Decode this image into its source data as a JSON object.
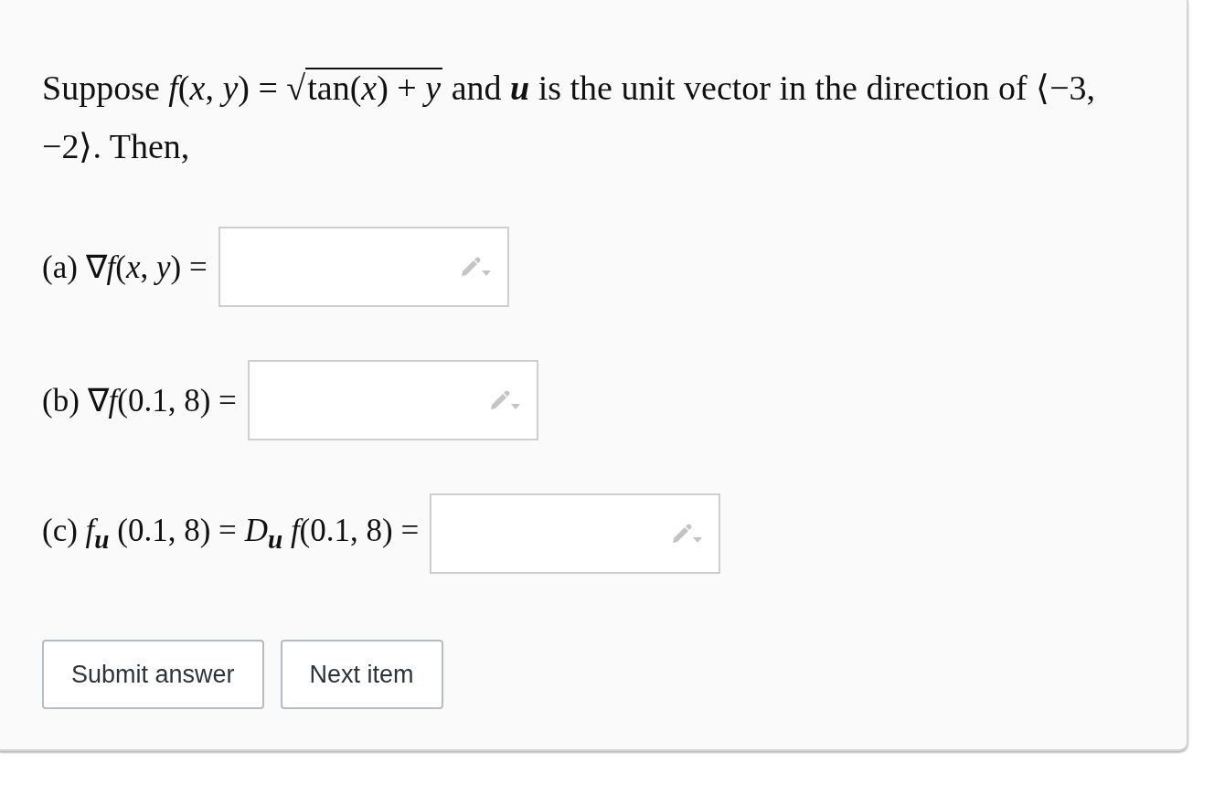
{
  "problem": {
    "before": "Suppose *f*(*x*, *y*) = √",
    "radicand": "tan(*x*) + *y*",
    "after": " and **u** is the unit vector in the direction of ⟨−3, −2⟩. Then,"
  },
  "parts": [
    {
      "label": "(a)",
      "expression": "∇*f*(*x*, *y*) ="
    },
    {
      "label": "(b)",
      "expression": "∇*f*(0.1, 8) ="
    },
    {
      "label": "(c)",
      "expression": "*f*$_{u}$ (0.1, 8) = *D*$_{u}$ *f*(0.1, 8) ="
    }
  ],
  "buttons": [
    {
      "label": "Submit answer"
    },
    {
      "label": "Next item"
    }
  ]
}
